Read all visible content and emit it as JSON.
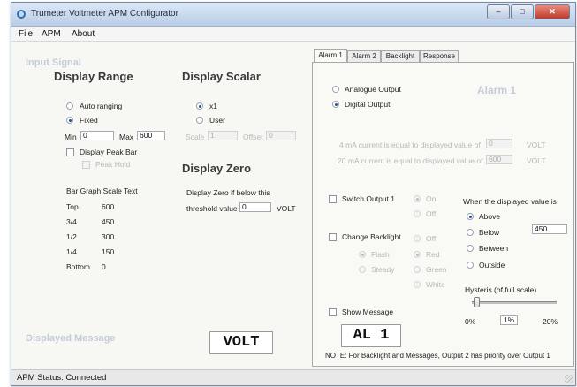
{
  "window": {
    "title": "Trumeter Voltmeter APM Configurator"
  },
  "menu": {
    "file": "File",
    "apm": "APM",
    "about": "About"
  },
  "ghost_labels": {
    "input_signal": "Input Signal",
    "displayed_message": "Displayed Message"
  },
  "display_range": {
    "heading": "Display Range",
    "auto_ranging": "Auto ranging",
    "fixed": "Fixed",
    "selected": "fixed",
    "min_label": "Min",
    "min_value": "0",
    "max_label": "Max",
    "max_value": "600",
    "peak_bar_label": "Display Peak Bar",
    "peak_hold_label": "Peak Hold"
  },
  "bar_graph": {
    "heading": "Bar Graph Scale Text",
    "rows": [
      {
        "label": "Top",
        "value": "600"
      },
      {
        "label": "3/4",
        "value": "450"
      },
      {
        "label": "1/2",
        "value": "300"
      },
      {
        "label": "1/4",
        "value": "150"
      },
      {
        "label": "Bottom",
        "value": "0"
      }
    ]
  },
  "display_scalar": {
    "heading": "Display Scalar",
    "x1": "x1",
    "user": "User",
    "selected": "x1",
    "scale_label": "Scale",
    "scale_value": "1",
    "offset_label": "Offset",
    "offset_value": "0"
  },
  "display_zero": {
    "heading": "Display Zero",
    "line1": "Display Zero if below this",
    "line2": "threshold value",
    "value": "0",
    "unit": "VOLT"
  },
  "message_preview": "VOLT",
  "tabs": [
    "Alarm 1",
    "Alarm 2",
    "Backlight",
    "Response"
  ],
  "alarm": {
    "ghost_title": "Alarm 1",
    "analogue_output": "Analogue Output",
    "digital_output": "Digital Output",
    "selected_output": "digital",
    "ma4_label": "4 mA current is equal to displayed value of",
    "ma4_value": "0",
    "ma4_unit": "VOLT",
    "ma20_label": "20 mA current is equal to displayed value of",
    "ma20_value": "600",
    "ma20_unit": "VOLT",
    "switch_output_label": "Switch Output 1",
    "on_label": "On",
    "off_label": "Off",
    "change_backlight_label": "Change Backlight",
    "backlight_off": "Off",
    "flash_label": "Flash",
    "steady_label": "Steady",
    "red_label": "Red",
    "green_label": "Green",
    "white_label": "White",
    "when_label": "When the displayed value is",
    "above": "Above",
    "below": "Below",
    "between": "Between",
    "outside": "Outside",
    "condition_selected": "above",
    "threshold_value": "450",
    "hysteresis_label": "Hysteris (of full scale)",
    "hysteresis_min": "0%",
    "hysteresis_value": "1%",
    "hysteresis_max": "20%",
    "hysteresis_fraction": 0.05,
    "show_message_label": "Show Message",
    "message_preview": "AL 1",
    "note": "NOTE: For Backlight and Messages, Output 2 has priority over Output 1"
  },
  "status": {
    "text": "APM Status:  Connected"
  }
}
